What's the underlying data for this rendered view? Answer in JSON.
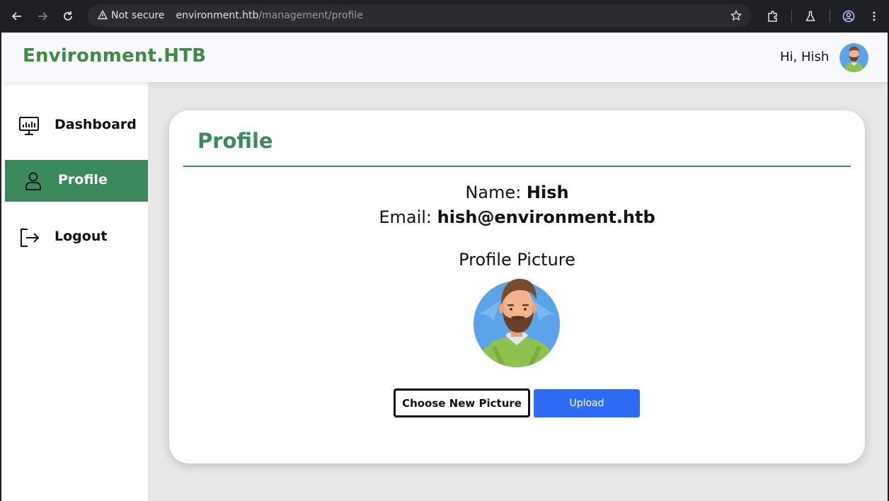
{
  "browser": {
    "security_label": "Not secure",
    "url_host": "environment.htb",
    "url_path": "/management/profile",
    "icons": [
      "back-arrow-icon",
      "forward-arrow-icon",
      "reload-icon",
      "warning-icon",
      "star-icon",
      "extensions-icon",
      "labs-flask-icon",
      "account-icon",
      "kebab-menu-icon"
    ]
  },
  "header": {
    "brand": "Environment.HTB",
    "greeting": "Hi, Hish"
  },
  "sidebar": {
    "items": [
      {
        "label": "Dashboard",
        "icon": "dashboard-monitor-icon",
        "active": false
      },
      {
        "label": "Profile",
        "icon": "user-icon",
        "active": true
      },
      {
        "label": "Logout",
        "icon": "logout-icon",
        "active": false
      }
    ]
  },
  "profile": {
    "title": "Profile",
    "name_label": "Name:",
    "name_value": "Hish",
    "email_label": "Email:",
    "email_value": "hish@environment.htb",
    "picture_title": "Profile Picture",
    "choose_label": "Choose New Picture",
    "upload_label": "Upload"
  },
  "colors": {
    "brand_green": "#3f8a45",
    "accent_green": "#3a8a5b",
    "upload_blue": "#2f6cf5"
  }
}
